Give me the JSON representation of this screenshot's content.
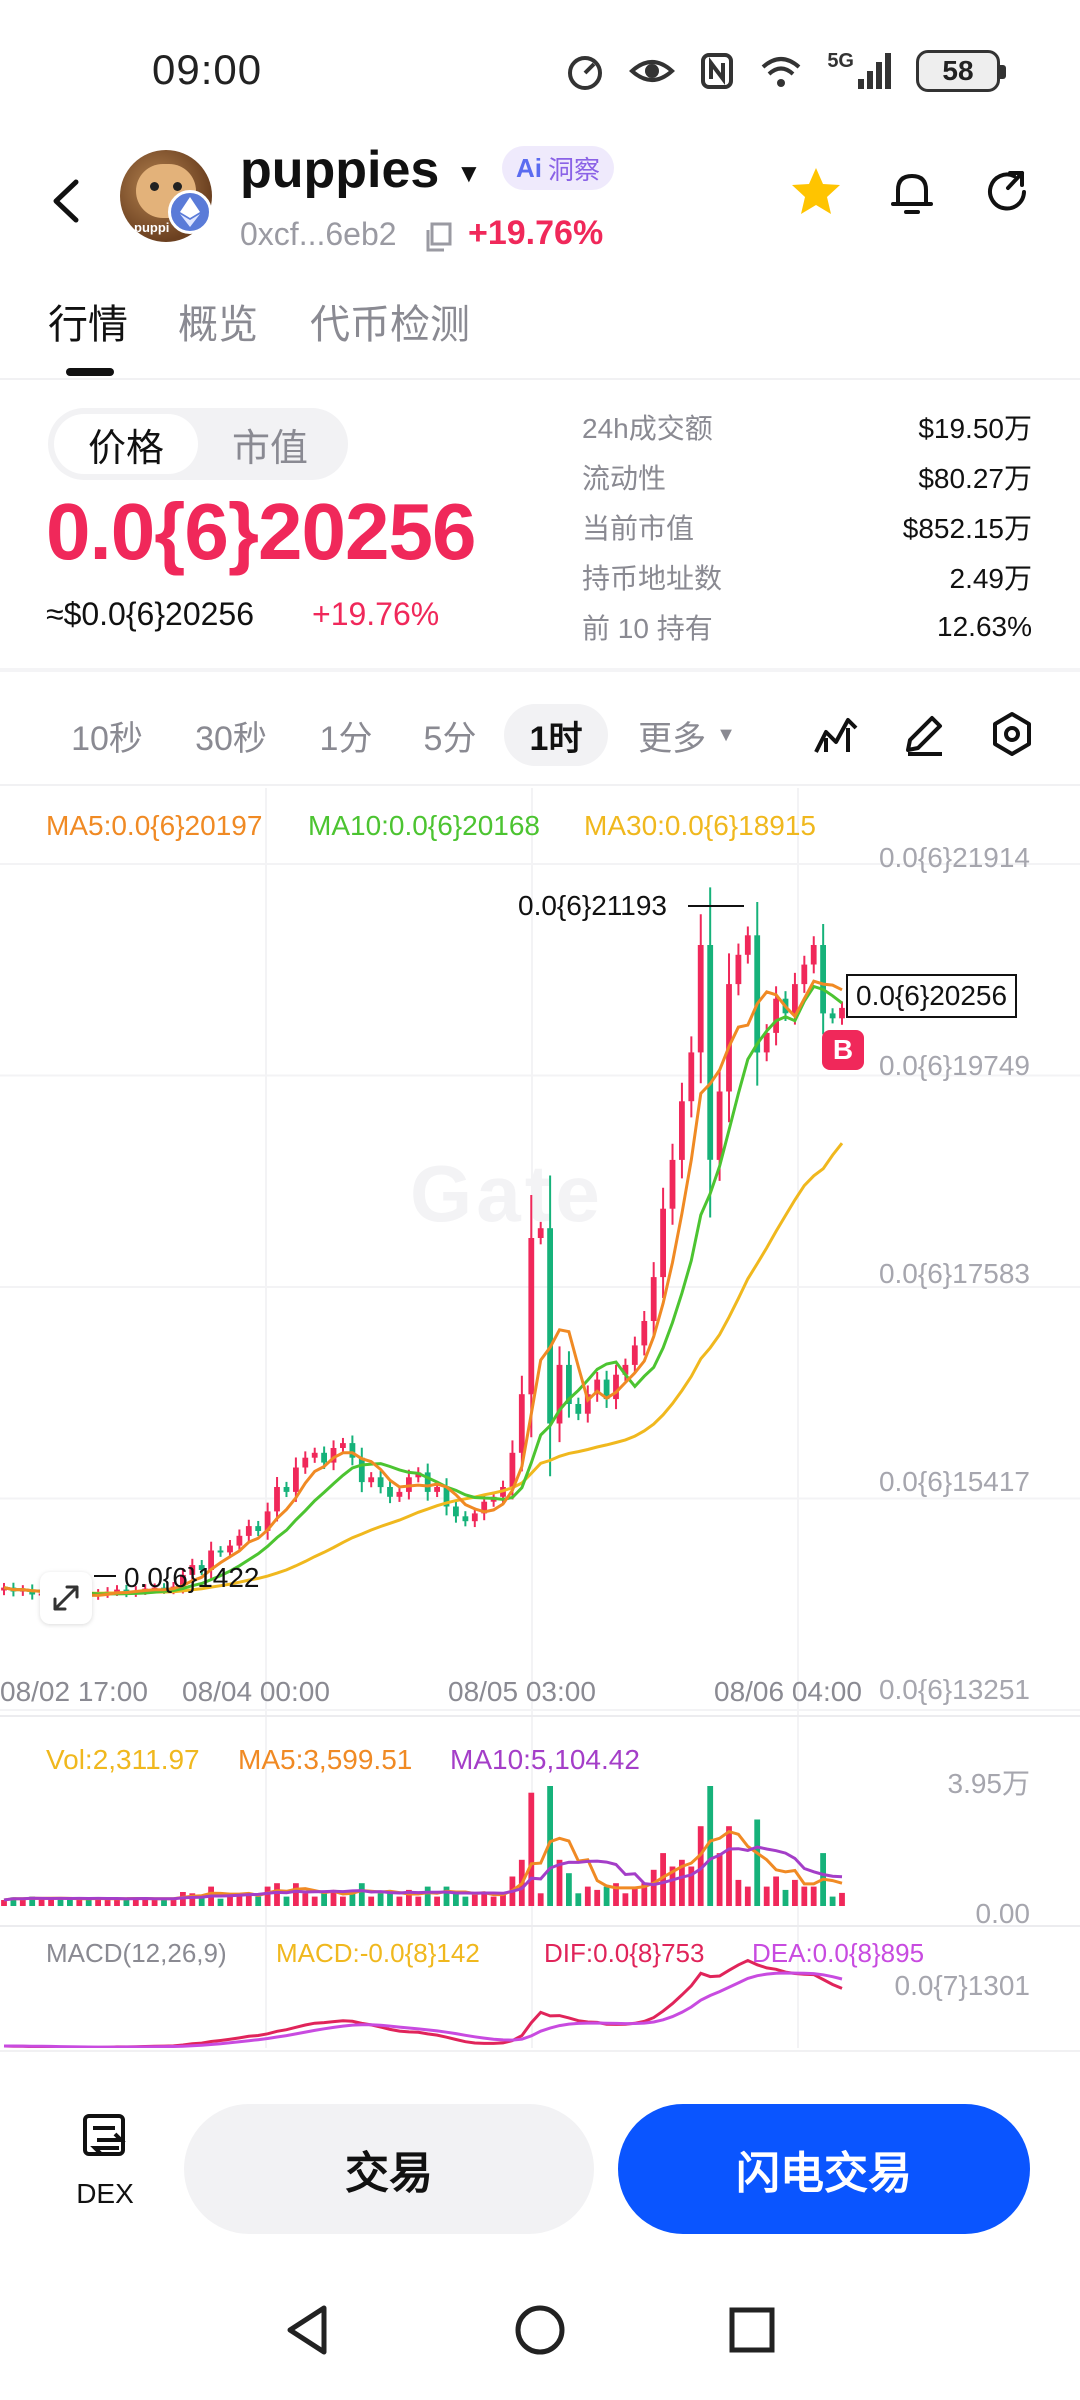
{
  "status_bar": {
    "time": "09:00",
    "network": "5G",
    "battery": "58"
  },
  "header": {
    "token_name": "puppies",
    "ai_label": "洞察",
    "ai_mark": "Ai",
    "address": "0xcf...6eb2",
    "change": "+19.76%",
    "avatar_text": "puppi"
  },
  "tabs": [
    "行情",
    "概览",
    "代币检测"
  ],
  "price": {
    "toggle": [
      "价格",
      "市值"
    ],
    "value": "0.0{6}20256",
    "usd": "≈$0.0{6}20256",
    "change": "+19.76%"
  },
  "stats": [
    {
      "label": "24h成交额",
      "value": "$19.50万"
    },
    {
      "label": "流动性",
      "value": "$80.27万"
    },
    {
      "label": "当前市值",
      "value": "$852.15万"
    },
    {
      "label": "持币地址数",
      "value": "2.49万"
    },
    {
      "label": "前 10 持有",
      "value": "12.63%"
    }
  ],
  "intervals": [
    "10秒",
    "30秒",
    "1分",
    "5分",
    "1时",
    "更多"
  ],
  "active_interval": "1时",
  "chart": {
    "ma_legend": {
      "ma5": "MA5:0.0{6}20197",
      "ma10": "MA10:0.0{6}20168",
      "ma30": "MA30:0.0{6}18915"
    },
    "y_labels": [
      "0.0{6}21914",
      "0.0{6}19749",
      "0.0{6}17583",
      "0.0{6}15417",
      "0.0{6}13251"
    ],
    "x_labels": [
      "08/02 17:00",
      "08/04 00:00",
      "08/05 03:00",
      "08/06 04:00"
    ],
    "current_price_tag": "0.0{6}20256",
    "high_label": "0.0{6}21193",
    "low_label": "0.0{6}1422",
    "buy_badge": "B",
    "watermark": "Gate",
    "vol_legend": {
      "vol": "Vol:2,311.97",
      "ma5": "MA5:3,599.51",
      "ma10": "MA10:5,104.42"
    },
    "vol_y_labels": [
      "3.95万",
      "0.00"
    ],
    "macd_legend": {
      "title": "MACD(12,26,9)",
      "macd": "MACD:-0.0{8}142",
      "dif": "DIF:0.0{8}753",
      "dea": "DEA:0.0{8}895"
    },
    "macd_y_label": "0.0{7}1301",
    "colors": {
      "up": "#f0285a",
      "down": "#16b27a",
      "ma5": "#f08a24",
      "ma10": "#4cc431",
      "ma30": "#f0b81e",
      "vol_ma10": "#a43ec8",
      "dea": "#c84be0"
    }
  },
  "chart_data": {
    "type": "candlestick",
    "interval": "1h",
    "y_range": [
      13251,
      21914
    ],
    "y_unit": "0.0{6}",
    "close": [
      14320,
      14280,
      14300,
      14250,
      14260,
      14270,
      14230,
      14220,
      14250,
      14240,
      14260,
      14280,
      14300,
      14270,
      14290,
      14310,
      14320,
      14300,
      14330,
      14450,
      14550,
      14500,
      14700,
      14680,
      14750,
      14850,
      14950,
      14900,
      15100,
      15350,
      15300,
      15550,
      15650,
      15700,
      15600,
      15750,
      15800,
      15650,
      15400,
      15450,
      15350,
      15250,
      15300,
      15450,
      15500,
      15300,
      15350,
      15150,
      15050,
      15000,
      15080,
      15200,
      15250,
      15350,
      15700,
      16300,
      17900,
      18000,
      16000,
      16600,
      16200,
      16100,
      16300,
      16450,
      16250,
      16500,
      16600,
      16800,
      17050,
      17500,
      18200,
      18700,
      19300,
      19800,
      20900,
      18700,
      19400,
      20500,
      20800,
      21000,
      19800,
      20000,
      20350,
      20200,
      20500,
      20700,
      20900,
      20200,
      20150,
      20256
    ]
  },
  "actions": {
    "dex_label": "DEX",
    "trade": "交易",
    "flash_trade": "闪电交易"
  }
}
